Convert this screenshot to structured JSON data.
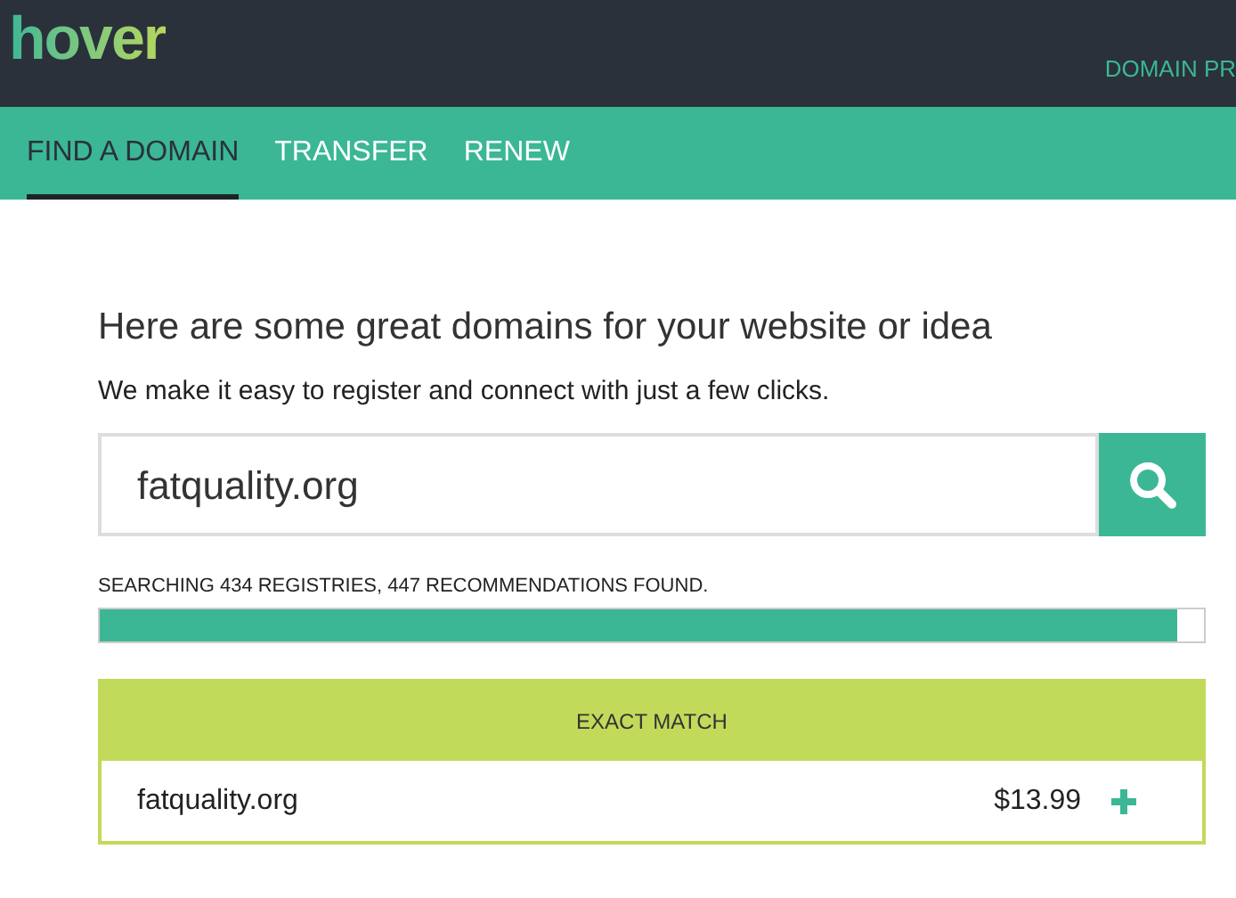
{
  "header": {
    "logo": "hover",
    "nav_link": "DOMAIN PR"
  },
  "tabs": [
    {
      "label": "FIND A DOMAIN",
      "selected": true
    },
    {
      "label": "TRANSFER",
      "selected": false
    },
    {
      "label": "RENEW",
      "selected": false
    }
  ],
  "heading": "Here are some great domains for your website or idea",
  "subheading": "We make it easy to register and connect with just a few clicks.",
  "search": {
    "value": "fatquality.org"
  },
  "progress": {
    "status": "SEARCHING 434 REGISTRIES, 447 RECOMMENDATIONS FOUND.",
    "level": 0.975
  },
  "exact_match": {
    "title": "EXACT MATCH",
    "domain": "fatquality.org",
    "price": "$13.99"
  }
}
